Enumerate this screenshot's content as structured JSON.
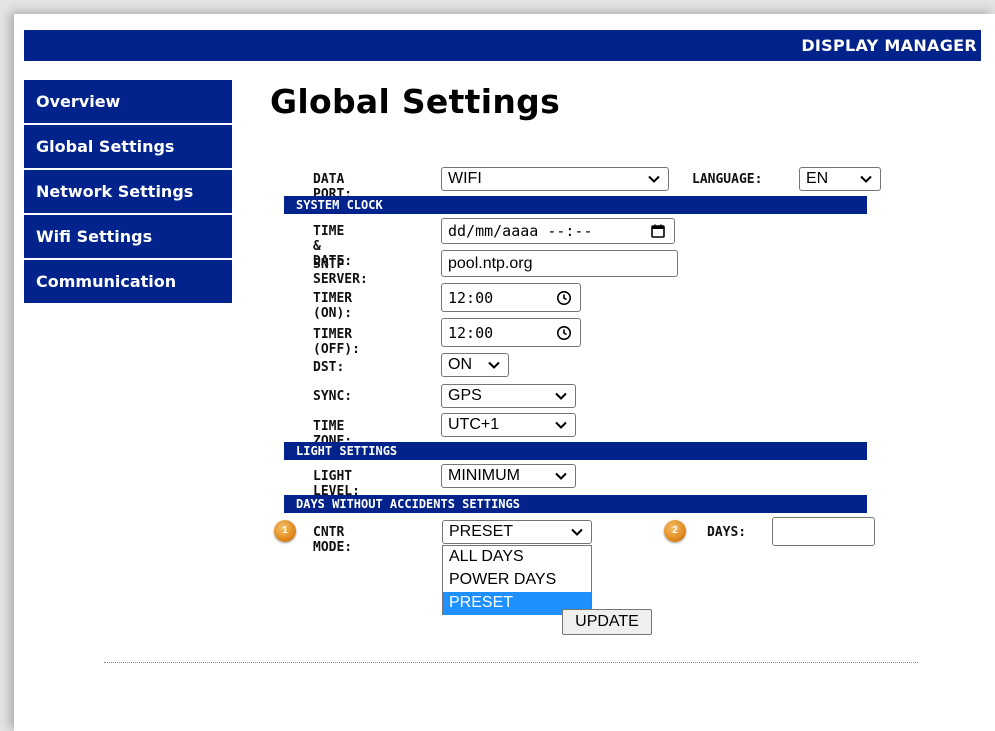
{
  "header": {
    "title": "DISPLAY MANAGER"
  },
  "sidebar": {
    "items": [
      {
        "label": "Overview"
      },
      {
        "label": "Global Settings"
      },
      {
        "label": "Network Settings"
      },
      {
        "label": "Wifi Settings"
      },
      {
        "label": "Communication"
      }
    ]
  },
  "page_title": "Global Settings",
  "form": {
    "data_port": {
      "label": "DATA PORT:",
      "value": "WIFI"
    },
    "language": {
      "label": "LANGUAGE:",
      "value": "EN"
    },
    "system_clock": {
      "section_title": "SYSTEM CLOCK",
      "time_date": {
        "label": "TIME & DATE:",
        "placeholder": "dd/mm/aaaa --:--"
      },
      "sntp_server": {
        "label": "SNTP SERVER:",
        "value": "pool.ntp.org"
      },
      "timer_on": {
        "label": "TIMER (ON):",
        "value": "12:00"
      },
      "timer_off": {
        "label": "TIMER (OFF):",
        "value": "12:00"
      },
      "dst": {
        "label": "DST:",
        "value": "ON"
      },
      "sync": {
        "label": "SYNC:",
        "value": "GPS"
      },
      "time_zone": {
        "label": "TIME ZONE:",
        "value": "UTC+1"
      }
    },
    "light_settings": {
      "section_title": "LIGHT SETTINGS",
      "light_level": {
        "label": "LIGHT LEVEL:",
        "value": "MINIMUM"
      }
    },
    "days_without_accidents": {
      "section_title": "DAYS WITHOUT ACCIDENTS SETTINGS",
      "cntr_mode": {
        "label": "CNTR MODE:",
        "value": "PRESET",
        "options": [
          "ALL DAYS",
          "POWER DAYS",
          "PRESET"
        ],
        "selected_option": "PRESET"
      },
      "days": {
        "label": "DAYS:",
        "value": ""
      }
    },
    "update_button": "UPDATE"
  },
  "annotations": {
    "badge_1": "1",
    "badge_2": "2"
  },
  "colors": {
    "brand_navy": "#02238c",
    "highlight": "#1e90ff",
    "badge_orange": "#e08a1e"
  }
}
